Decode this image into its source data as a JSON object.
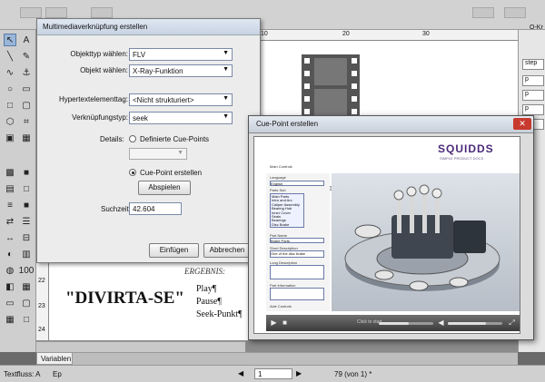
{
  "dialog1": {
    "title": "Multimediaverknüpfung erstellen",
    "fields": {
      "objekttyp_label": "Objekttyp wählen:",
      "objekttyp_value": "FLV",
      "objekt_label": "Objekt wählen:",
      "objekt_value": "X-Ray-Funktion",
      "hypertext_label": "Hypertextelementtag:",
      "hypertext_value": "<Nicht strukturiert>",
      "verknuepfung_label": "Verknüpfungstyp:",
      "verknuepfung_value": "seek",
      "details_label": "Details:",
      "radio_defined": "Definierte Cue-Points",
      "radio_create": "Cue-Point erstellen",
      "abspielen_button": "Abspielen",
      "suchzeit_label": "Suchzeit:",
      "suchzeit_value": "42.604"
    },
    "buttons": {
      "einfuegen": "Einfügen",
      "abbrechen": "Abbrechen"
    }
  },
  "dialog2": {
    "title": "Cue-Point erstellen",
    "close_glyph": "✕",
    "brand": "SQUIDDS",
    "brand_sub": "SIMPLE PRODUCT DOCS",
    "sidebar_list": [
      "Main Parts",
      "Intro and Arc",
      "Caliper Assembly",
      "Bearing Hub",
      "Inner Cover",
      "Seals",
      "Bearings",
      "Disc Brake"
    ],
    "sidebar_labels": [
      "Main Controls",
      "Language",
      "English",
      "Parts Sub",
      "Part Name",
      "Brake Parts",
      "Short Description",
      "One of the disc brake",
      "Long Description",
      "Part Information",
      "Axle Controls"
    ],
    "video_hint": "Click to start",
    "progress_fraction": 0.55
  },
  "document": {
    "title": "\"DIVIRTA-SE\"",
    "ergebnis": "ERGEBNIS:",
    "items": [
      "Play¶",
      "Pause¶",
      "Seek-Punkt¶"
    ],
    "ruler_marks": [
      "10",
      "20",
      "30"
    ],
    "line_numbers": [
      "22",
      "23",
      "24"
    ]
  },
  "right_panel": {
    "title": "O-Kr",
    "items": [
      "step",
      "p",
      "p",
      "p",
      "p"
    ]
  },
  "status": {
    "textfluss": "Textfluss: A",
    "ep": "Ep",
    "page_input": "1",
    "page_info": "79 (von 1) *",
    "zoom": "100",
    "variablen_tab": "Variablen"
  }
}
